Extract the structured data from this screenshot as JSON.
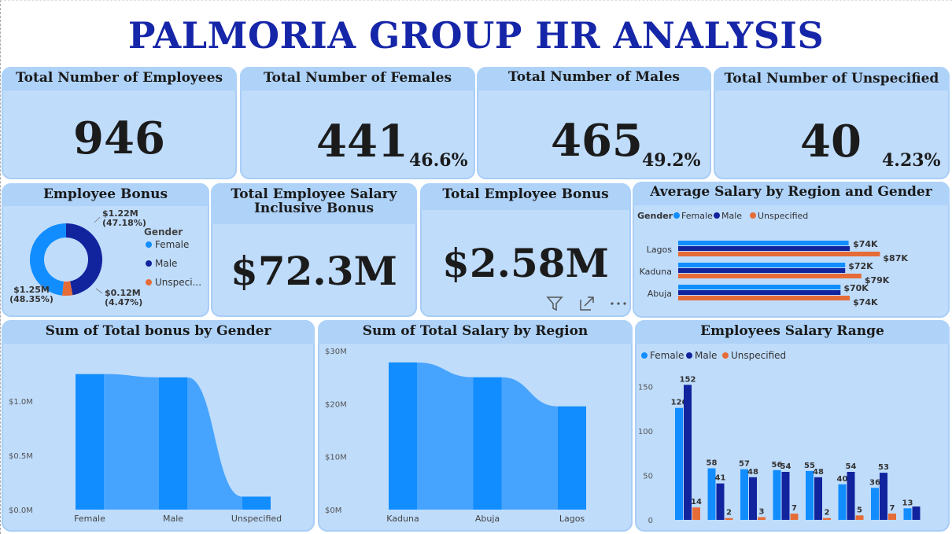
{
  "header": {
    "title": "PALMORIA GROUP HR ANALYSIS"
  },
  "kpis": {
    "employees": {
      "label": "Total Number of Employees",
      "value": "946"
    },
    "females": {
      "label": "Total Number of Females",
      "value": "441",
      "pct": "46.6%"
    },
    "males": {
      "label": "Total Number of Males",
      "value": "465",
      "pct": "49.2%"
    },
    "unspecified": {
      "label": "Total Number of Unspecified",
      "value": "40",
      "pct": "4.23%"
    },
    "salary": {
      "label": "Total Employee Salary Inclusive Bonus",
      "value": "$72.3M"
    },
    "bonus": {
      "label": "Total Employee Bonus",
      "value": "$2.58M"
    }
  },
  "colors": {
    "female": "#118dff",
    "male": "#12239e",
    "unspecified": "#e66c37",
    "card_bg": "#bfdcfb",
    "header_bg": "#aed2f8",
    "title": "#1626a8",
    "area": "#46a4ff"
  },
  "icons": [
    "filter-icon",
    "focus-mode-icon",
    "more-options-icon"
  ],
  "chart_data": [
    {
      "id": "employee_bonus",
      "type": "pie",
      "title": "Employee Bonus",
      "legend_title": "Gender",
      "legend_position": "right",
      "categories": [
        "Female",
        "Male",
        "Unspecified"
      ],
      "legend_labels": [
        "Female",
        "Male",
        "Unspeci..."
      ],
      "values": [
        1.25,
        1.22,
        0.12
      ],
      "value_labels": [
        "$1.25M",
        "$1.22M",
        "$0.12M"
      ],
      "percent_labels": [
        "(48.35%)",
        "(47.18%)",
        "(4.47%)"
      ]
    },
    {
      "id": "avg_salary_region_gender",
      "type": "bar",
      "orientation": "horizontal",
      "title": "Average Salary by Region and Gender",
      "legend_title": "Gender",
      "legend_position": "top-left",
      "categories": [
        "Lagos",
        "Kaduna",
        "Abuja"
      ],
      "series": [
        {
          "name": "Female",
          "values": [
            73.5,
            72.0,
            70.0
          ],
          "labels": [
            "",
            "",
            ""
          ]
        },
        {
          "name": "Male",
          "values": [
            74.0,
            72.0,
            70.0
          ],
          "labels": [
            "$74K",
            "$72K",
            "$70K"
          ]
        },
        {
          "name": "Unspecified",
          "values": [
            87.0,
            79.0,
            74.0
          ],
          "labels": [
            "$87K",
            "$79K",
            "$74K"
          ]
        }
      ],
      "xlim": [
        0,
        95
      ]
    },
    {
      "id": "bonus_by_gender",
      "type": "bar",
      "title": "Sum of Total bonus by Gender",
      "categories": [
        "Female",
        "Male",
        "Unspecified"
      ],
      "values": [
        1.25,
        1.22,
        0.12
      ],
      "ylim": [
        0,
        1.4
      ],
      "yticks": [
        0,
        0.5,
        1.0
      ],
      "ytick_labels": [
        "$0.0M",
        "$0.5M",
        "$1.0M"
      ]
    },
    {
      "id": "salary_by_region",
      "type": "bar",
      "title": "Sum of Total Salary by Region",
      "categories": [
        "Kaduna",
        "Abuja",
        "Lagos"
      ],
      "values": [
        27.8,
        25.0,
        19.5
      ],
      "ylim": [
        0,
        30
      ],
      "yticks": [
        0,
        10,
        20,
        30
      ],
      "ytick_labels": [
        "$0M",
        "$10M",
        "$20M",
        "$30M"
      ]
    },
    {
      "id": "salary_range",
      "type": "bar",
      "title": "Employees Salary Range",
      "legend_position": "top-left",
      "categories": [
        "",
        "",
        "",
        "",
        "",
        "",
        "",
        ""
      ],
      "series": [
        {
          "name": "Female",
          "values": [
            126,
            58,
            57,
            56,
            55,
            40,
            36,
            13
          ]
        },
        {
          "name": "Male",
          "values": [
            152,
            41,
            48,
            54,
            48,
            54,
            53,
            15
          ]
        },
        {
          "name": "Unspecified",
          "values": [
            14,
            2,
            3,
            7,
            2,
            5,
            7,
            0
          ]
        }
      ],
      "ylim": [
        0,
        170
      ],
      "yticks": [
        0,
        50,
        100,
        150
      ],
      "ytick_labels": [
        "0",
        "50",
        "100",
        "150"
      ]
    }
  ]
}
